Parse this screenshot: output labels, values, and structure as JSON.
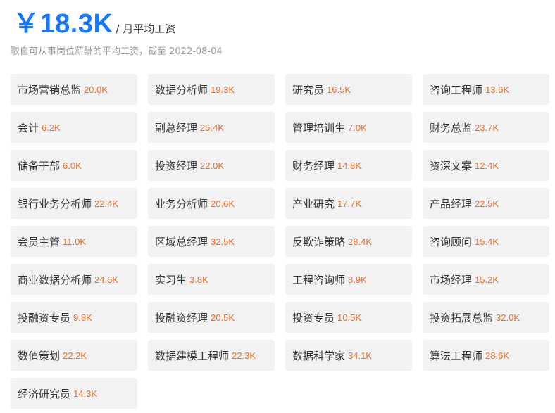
{
  "header": {
    "value": "￥18.3K",
    "unit": "/ 月平均工资"
  },
  "note": "取自可从事岗位薪酬的平均工资，截至 2022-08-04",
  "colors": {
    "accent": "#1677ff",
    "salary": "#f26b21",
    "item_bg": "#f2f2f2"
  },
  "jobs": [
    {
      "name": "市场营销总监",
      "salary": "20.0K"
    },
    {
      "name": "数据分析师",
      "salary": "19.3K"
    },
    {
      "name": "研究员",
      "salary": "16.5K"
    },
    {
      "name": "咨询工程师",
      "salary": "13.6K"
    },
    {
      "name": "会计",
      "salary": "6.2K"
    },
    {
      "name": "副总经理",
      "salary": "25.4K"
    },
    {
      "name": "管理培训生",
      "salary": "7.0K"
    },
    {
      "name": "财务总监",
      "salary": "23.7K"
    },
    {
      "name": "储备干部",
      "salary": "6.0K"
    },
    {
      "name": "投资经理",
      "salary": "22.0K"
    },
    {
      "name": "财务经理",
      "salary": "14.8K"
    },
    {
      "name": "资深文案",
      "salary": "12.4K"
    },
    {
      "name": "银行业务分析师",
      "salary": "22.4K"
    },
    {
      "name": "业务分析师",
      "salary": "20.6K"
    },
    {
      "name": "产业研究",
      "salary": "17.7K"
    },
    {
      "name": "产品经理",
      "salary": "22.5K"
    },
    {
      "name": "会员主管",
      "salary": "11.0K"
    },
    {
      "name": "区域总经理",
      "salary": "32.5K"
    },
    {
      "name": "反欺诈策略",
      "salary": "28.4K"
    },
    {
      "name": "咨询顾问",
      "salary": "15.4K"
    },
    {
      "name": "商业数据分析师",
      "salary": "24.6K"
    },
    {
      "name": "实习生",
      "salary": "3.8K"
    },
    {
      "name": "工程咨询师",
      "salary": "8.9K"
    },
    {
      "name": "市场经理",
      "salary": "15.2K"
    },
    {
      "name": "投融资专员",
      "salary": "9.8K"
    },
    {
      "name": "投融资经理",
      "salary": "20.5K"
    },
    {
      "name": "投资专员",
      "salary": "10.5K"
    },
    {
      "name": "投资拓展总监",
      "salary": "32.0K"
    },
    {
      "name": "数值策划",
      "salary": "22.2K"
    },
    {
      "name": "数据建模工程师",
      "salary": "22.3K"
    },
    {
      "name": "数据科学家",
      "salary": "34.1K"
    },
    {
      "name": "算法工程师",
      "salary": "28.6K"
    },
    {
      "name": "经济研究员",
      "salary": "14.3K"
    }
  ]
}
